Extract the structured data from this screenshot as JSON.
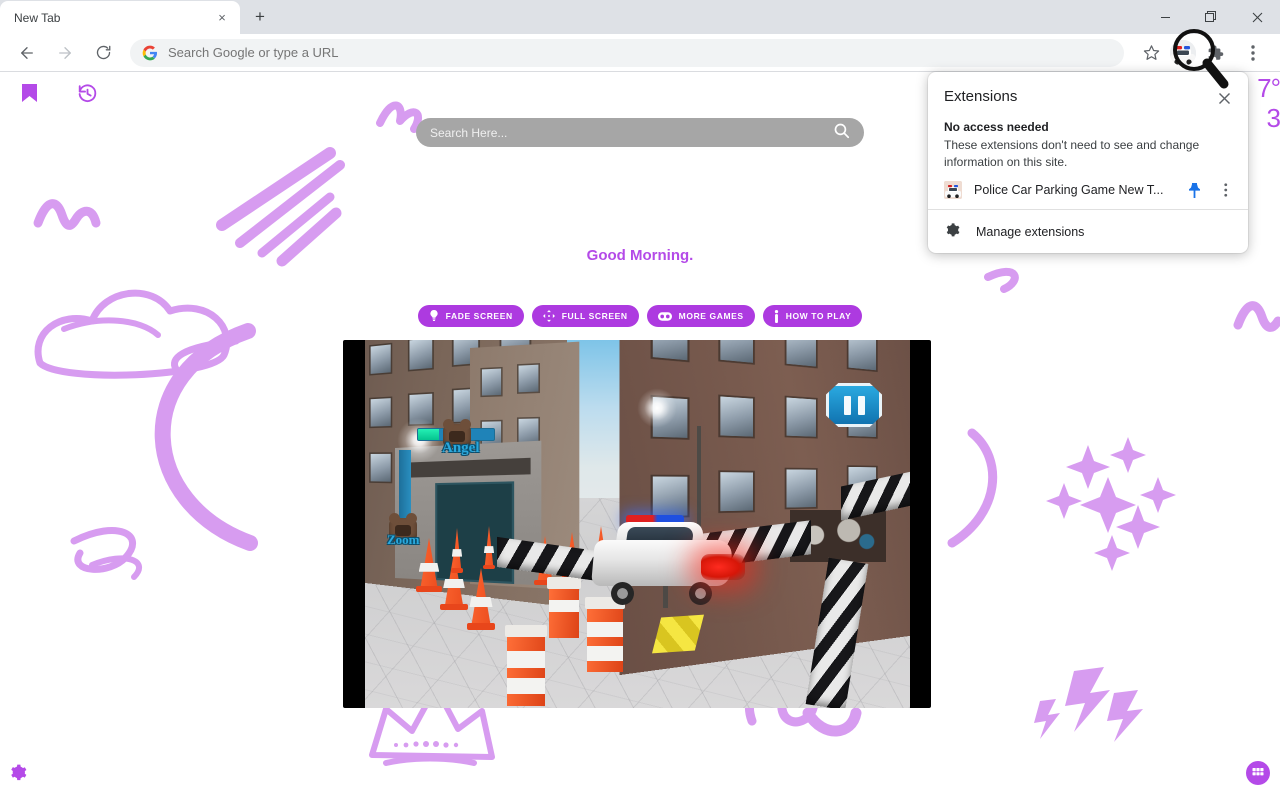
{
  "window": {
    "minimize_label": "Minimize",
    "maximize_label": "Maximize",
    "close_label": "Close"
  },
  "tabstrip": {
    "tab_title": "New Tab",
    "close_glyph": "×",
    "newtab_glyph": "+"
  },
  "toolbar": {
    "back_label": "Back",
    "forward_label": "Forward",
    "reload_label": "Reload",
    "omnibox_placeholder": "Search Google or type a URL",
    "omnibox_value": "",
    "bookmark_star_label": "Bookmark this tab",
    "extensions_puzzle_label": "Extensions",
    "menu_label": "Customize and control Google Chrome"
  },
  "newtab": {
    "bookmarks_icon_label": "Bookmarks",
    "history_icon_label": "History",
    "settings_icon_label": "Settings",
    "apps_icon_label": "Apps",
    "weather": {
      "temp_top": "7°",
      "temp_bottom": "3"
    },
    "search": {
      "placeholder": "Search Here...",
      "value": ""
    },
    "greeting": "Good Morning.",
    "buttons": [
      {
        "label": "FADE SCREEN",
        "icon": "bulb-icon"
      },
      {
        "label": "FULL SCREEN",
        "icon": "expand-arrows-icon"
      },
      {
        "label": "MORE GAMES",
        "icon": "gamepad-icon"
      },
      {
        "label": "HOW TO PLAY",
        "icon": "info-icon"
      }
    ],
    "accent_color": "#ad3ae0",
    "doodle_color": "#d79cf0"
  },
  "game": {
    "title": "Police Car Parking Game",
    "player_name": "Angel",
    "second_label": "Zoom",
    "health_percent": 28,
    "pause_label": "Pause"
  },
  "extensions_popup": {
    "title": "Extensions",
    "close_glyph": "×",
    "section_heading": "No access needed",
    "section_body": "These extensions don't need to see and change information on this site.",
    "items": [
      {
        "name": "Police Car Parking Game New T...",
        "pinned": true,
        "pin_label": "Unpin",
        "more_label": "More options"
      }
    ],
    "manage_label": "Manage extensions",
    "manage_icon": "gear-icon",
    "pin_color": "#1a73e8"
  }
}
